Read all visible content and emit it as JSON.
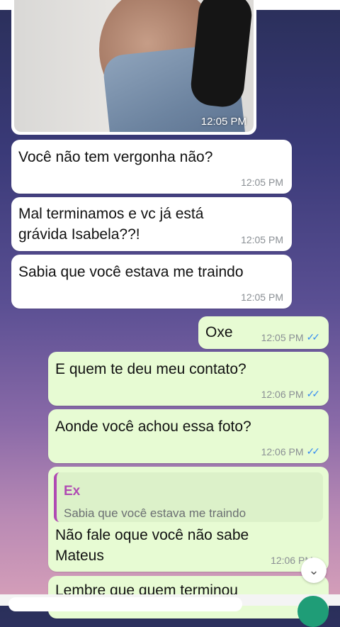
{
  "messages": {
    "photo": {
      "time": "12:05 PM"
    },
    "m1": {
      "text": "Você não tem vergonha não?",
      "time": "12:05 PM"
    },
    "m2": {
      "line1": "Mal terminamos e vc já está",
      "line2": "grávida Isabela??!",
      "time": "12:05 PM"
    },
    "m3": {
      "text": "Sabia que você estava me traindo",
      "time": "12:05 PM"
    },
    "m4": {
      "text": "Oxe",
      "time": "12:05 PM"
    },
    "m5": {
      "text": "E quem te deu meu contato?",
      "time": "12:06 PM"
    },
    "m6": {
      "text": "Aonde você achou essa foto?",
      "time": "12:06 PM"
    },
    "m7": {
      "reply_name": "Ex",
      "reply_text": "Sabia que você estava me traindo",
      "line1": "Não fale oque você não sabe",
      "line2": "Mateus",
      "time": "12:06 PM"
    },
    "m8": {
      "text": "Lembre que quem terminou"
    }
  },
  "colors": {
    "incoming_bubble": "#ffffff",
    "outgoing_bubble": "#e7fbd3",
    "read_tick": "#3a8ff0",
    "reply_accent": "#b04bb3"
  },
  "icons": {
    "read_receipt": "double-check-icon",
    "scroll_down": "double-chevron-down-icon"
  }
}
